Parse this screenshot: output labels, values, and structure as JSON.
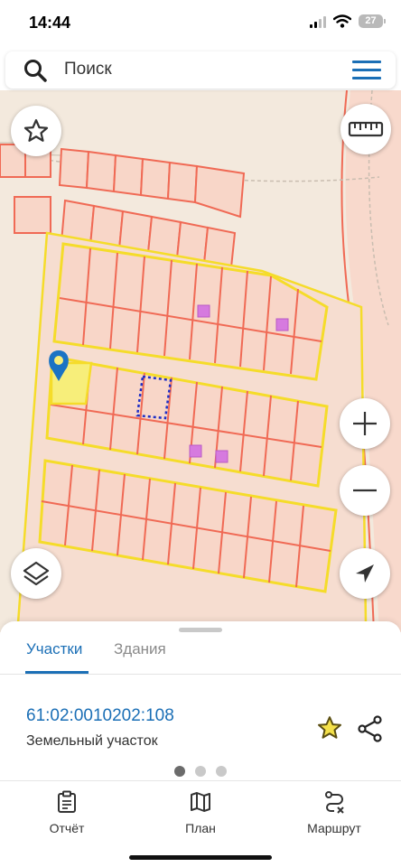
{
  "status_bar": {
    "time": "14:44",
    "battery": "27"
  },
  "search": {
    "placeholder": "Поиск"
  },
  "sheet": {
    "tabs": [
      {
        "label": "Участки",
        "active": true
      },
      {
        "label": "Здания",
        "active": false
      }
    ],
    "parcel": {
      "id": "61:02:0010202:108",
      "type": "Земельный участок"
    },
    "pager": {
      "pages": 3,
      "current": 1
    }
  },
  "bottom_nav": {
    "items": [
      {
        "label": "Отчёт",
        "icon": "report-icon"
      },
      {
        "label": "План",
        "icon": "map-icon"
      },
      {
        "label": "Маршрут",
        "icon": "route-icon"
      }
    ]
  },
  "colors": {
    "accent": "#1b6fb6",
    "map_background": "#f3e9dd",
    "parcel_border": "#f06a55",
    "block_border": "#f5dc2a",
    "selected_parcel": "#f7ee7a",
    "building": "#d67adf",
    "marker": "#1b73c4"
  }
}
